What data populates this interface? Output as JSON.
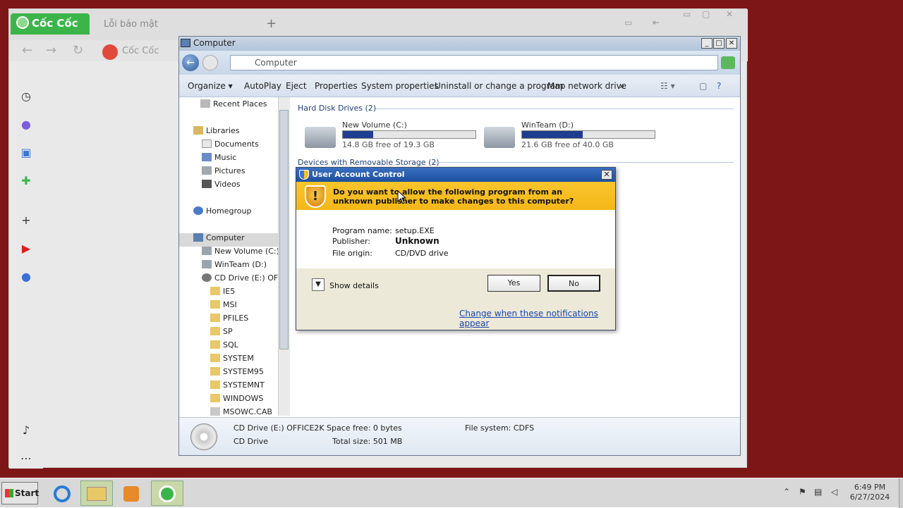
{
  "browser": {
    "brand": "Cốc Cốc",
    "tab2_label": "Lỗi bảo mật",
    "new_tab_glyph": "+",
    "address_text": "Cốc Cốc",
    "window_controls": [
      "▭",
      "▢",
      "✕"
    ],
    "nav": {
      "back": "←",
      "forward": "→",
      "reload": "↻"
    },
    "sidebar_icons": [
      "history-icon",
      "messenger-icon",
      "notes-icon",
      "games-icon",
      "add-icon",
      "youtube-icon",
      "facebook-icon",
      "bell-icon",
      "more-icon"
    ],
    "accent_color": "#3bb54a"
  },
  "explorer": {
    "title": "Computer",
    "address": "Computer",
    "toolbar": [
      "Organize ▾",
      "AutoPlay",
      "Eject",
      "Properties",
      "System properties",
      "Uninstall or change a program",
      "Map network drive",
      "»"
    ],
    "nav_items": [
      {
        "label": "Recent Places"
      },
      {
        "label": "Libraries"
      },
      {
        "label": "Documents"
      },
      {
        "label": "Music"
      },
      {
        "label": "Pictures"
      },
      {
        "label": "Videos"
      },
      {
        "label": "Homegroup"
      },
      {
        "label": "Computer"
      },
      {
        "label": "New Volume (C:)"
      },
      {
        "label": "WinTeam (D:)"
      },
      {
        "label": "CD Drive (E:) OFFI"
      },
      {
        "label": "IE5"
      },
      {
        "label": "MSI"
      },
      {
        "label": "PFILES"
      },
      {
        "label": "SP"
      },
      {
        "label": "SQL"
      },
      {
        "label": "SYSTEM"
      },
      {
        "label": "SYSTEM95"
      },
      {
        "label": "SYSTEMNT"
      },
      {
        "label": "WINDOWS"
      },
      {
        "label": "MSOWC.CAB"
      }
    ],
    "group_hdd": "Hard Disk Drives (2)",
    "group_removable": "Devices with Removable Storage (2)",
    "drives": [
      {
        "name": "New Volume (C:)",
        "free": "14.8 GB free of 19.3 GB",
        "used_fraction": 0.23
      },
      {
        "name": "WinTeam (D:)",
        "free": "21.6 GB free of 40.0 GB",
        "used_fraction": 0.46
      }
    ],
    "status": {
      "name": "CD Drive (E:) OFFICE2K",
      "type": "CD Drive",
      "space_free": "Space free: 0 bytes",
      "total_size": "Total size: 501 MB",
      "file_system": "File system: CDFS"
    }
  },
  "uac": {
    "title": "User Account Control",
    "question": "Do you want to allow the following program from an unknown publisher to make changes to this computer?",
    "program_label": "Program name:",
    "program_value": "setup.EXE",
    "publisher_label": "Publisher:",
    "publisher_value": "Unknown",
    "origin_label": "File origin:",
    "origin_value": "CD/DVD drive",
    "show_details": "Show details",
    "yes": "Yes",
    "no": "No",
    "link": "Change when these notifications appear",
    "close_glyph": "✕"
  },
  "taskbar": {
    "start": "Start",
    "time": "6:49 PM",
    "date": "6/27/2024",
    "apps": [
      "ie-icon",
      "explorer-icon",
      "media-player-icon",
      "coccoc-icon"
    ]
  }
}
